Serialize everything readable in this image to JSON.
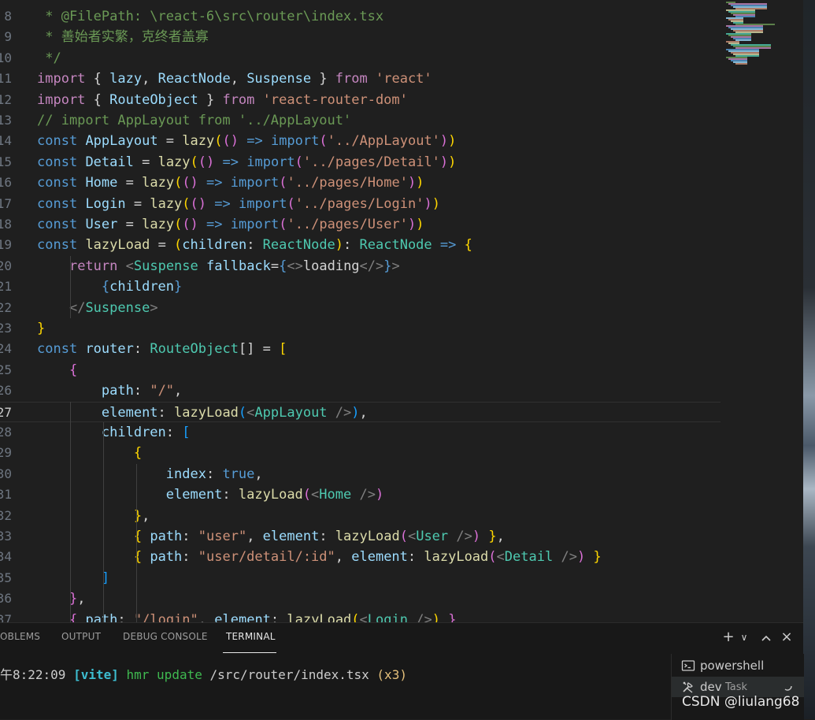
{
  "editor": {
    "current_line": 27,
    "lines": [
      {
        "n": "8",
        "t": [
          [
            "c-g",
            " * @FilePath: \\react-6\\src\\router\\index.tsx"
          ]
        ]
      },
      {
        "n": "9",
        "t": [
          [
            "c-g",
            " * 善始者实繁，克终者盖寡"
          ]
        ]
      },
      {
        "n": "10",
        "t": [
          [
            "c-g",
            " */"
          ]
        ]
      },
      {
        "n": "11",
        "t": [
          [
            "c-c",
            "import"
          ],
          [
            "c-w",
            " { "
          ],
          [
            "c-v",
            "lazy"
          ],
          [
            "c-w",
            ", "
          ],
          [
            "c-v",
            "ReactNode"
          ],
          [
            "c-w",
            ", "
          ],
          [
            "c-v",
            "Suspense"
          ],
          [
            "c-w",
            " } "
          ],
          [
            "c-c",
            "from"
          ],
          [
            "c-w",
            " "
          ],
          [
            "c-s",
            "'react'"
          ]
        ]
      },
      {
        "n": "12",
        "t": [
          [
            "c-c",
            "import"
          ],
          [
            "c-w",
            " { "
          ],
          [
            "c-v",
            "RouteObject"
          ],
          [
            "c-w",
            " } "
          ],
          [
            "c-c",
            "from"
          ],
          [
            "c-w",
            " "
          ],
          [
            "c-s",
            "'react-router-dom'"
          ]
        ]
      },
      {
        "n": "13",
        "t": [
          [
            "c-g",
            "// import AppLayout from '../AppLayout'"
          ]
        ]
      },
      {
        "n": "14",
        "t": [
          [
            "c-k",
            "const"
          ],
          [
            "c-w",
            " "
          ],
          [
            "c-v",
            "AppLayout"
          ],
          [
            "c-w",
            " = "
          ],
          [
            "c-f",
            "lazy"
          ],
          [
            "c-y",
            "("
          ],
          [
            "c-m",
            "()"
          ],
          [
            "c-w",
            " "
          ],
          [
            "c-k",
            "=>"
          ],
          [
            "c-w",
            " "
          ],
          [
            "c-k",
            "import"
          ],
          [
            "c-m",
            "("
          ],
          [
            "c-s",
            "'../AppLayout'"
          ],
          [
            "c-m",
            ")"
          ],
          [
            "c-y",
            ")"
          ]
        ]
      },
      {
        "n": "15",
        "t": [
          [
            "c-k",
            "const"
          ],
          [
            "c-w",
            " "
          ],
          [
            "c-v",
            "Detail"
          ],
          [
            "c-w",
            " = "
          ],
          [
            "c-f",
            "lazy"
          ],
          [
            "c-y",
            "("
          ],
          [
            "c-m",
            "()"
          ],
          [
            "c-w",
            " "
          ],
          [
            "c-k",
            "=>"
          ],
          [
            "c-w",
            " "
          ],
          [
            "c-k",
            "import"
          ],
          [
            "c-m",
            "("
          ],
          [
            "c-s",
            "'../pages/Detail'"
          ],
          [
            "c-m",
            ")"
          ],
          [
            "c-y",
            ")"
          ]
        ]
      },
      {
        "n": "16",
        "t": [
          [
            "c-k",
            "const"
          ],
          [
            "c-w",
            " "
          ],
          [
            "c-v",
            "Home"
          ],
          [
            "c-w",
            " = "
          ],
          [
            "c-f",
            "lazy"
          ],
          [
            "c-y",
            "("
          ],
          [
            "c-m",
            "()"
          ],
          [
            "c-w",
            " "
          ],
          [
            "c-k",
            "=>"
          ],
          [
            "c-w",
            " "
          ],
          [
            "c-k",
            "import"
          ],
          [
            "c-m",
            "("
          ],
          [
            "c-s",
            "'../pages/Home'"
          ],
          [
            "c-m",
            ")"
          ],
          [
            "c-y",
            ")"
          ]
        ]
      },
      {
        "n": "17",
        "t": [
          [
            "c-k",
            "const"
          ],
          [
            "c-w",
            " "
          ],
          [
            "c-v",
            "Login"
          ],
          [
            "c-w",
            " = "
          ],
          [
            "c-f",
            "lazy"
          ],
          [
            "c-y",
            "("
          ],
          [
            "c-m",
            "()"
          ],
          [
            "c-w",
            " "
          ],
          [
            "c-k",
            "=>"
          ],
          [
            "c-w",
            " "
          ],
          [
            "c-k",
            "import"
          ],
          [
            "c-m",
            "("
          ],
          [
            "c-s",
            "'../pages/Login'"
          ],
          [
            "c-m",
            ")"
          ],
          [
            "c-y",
            ")"
          ]
        ]
      },
      {
        "n": "18",
        "t": [
          [
            "c-k",
            "const"
          ],
          [
            "c-w",
            " "
          ],
          [
            "c-v",
            "User"
          ],
          [
            "c-w",
            " = "
          ],
          [
            "c-f",
            "lazy"
          ],
          [
            "c-y",
            "("
          ],
          [
            "c-m",
            "()"
          ],
          [
            "c-w",
            " "
          ],
          [
            "c-k",
            "=>"
          ],
          [
            "c-w",
            " "
          ],
          [
            "c-k",
            "import"
          ],
          [
            "c-m",
            "("
          ],
          [
            "c-s",
            "'../pages/User'"
          ],
          [
            "c-m",
            ")"
          ],
          [
            "c-y",
            ")"
          ]
        ]
      },
      {
        "n": "19",
        "t": [
          [
            "c-k",
            "const"
          ],
          [
            "c-w",
            " "
          ],
          [
            "c-f",
            "lazyLoad"
          ],
          [
            "c-w",
            " = "
          ],
          [
            "c-y",
            "("
          ],
          [
            "c-v",
            "children"
          ],
          [
            "c-w",
            ": "
          ],
          [
            "c-t",
            "ReactNode"
          ],
          [
            "c-y",
            ")"
          ],
          [
            "c-w",
            ": "
          ],
          [
            "c-t",
            "ReactNode"
          ],
          [
            "c-w",
            " "
          ],
          [
            "c-k",
            "=>"
          ],
          [
            "c-w",
            " "
          ],
          [
            "c-y",
            "{"
          ]
        ]
      },
      {
        "n": "20",
        "t": [
          [
            "c-w",
            "    "
          ],
          [
            "c-c",
            "return"
          ],
          [
            "c-w",
            " "
          ],
          [
            "c-p",
            "<"
          ],
          [
            "c-t",
            "Suspense"
          ],
          [
            "c-w",
            " "
          ],
          [
            "c-v",
            "fallback"
          ],
          [
            "c-w",
            "="
          ],
          [
            "c-k",
            "{"
          ],
          [
            "c-p",
            "<>"
          ],
          [
            "c-w",
            "loading"
          ],
          [
            "c-p",
            "</>"
          ],
          [
            "c-k",
            "}"
          ],
          [
            "c-p",
            ">"
          ]
        ]
      },
      {
        "n": "21",
        "t": [
          [
            "c-w",
            "        "
          ],
          [
            "c-k",
            "{"
          ],
          [
            "c-v",
            "children"
          ],
          [
            "c-k",
            "}"
          ]
        ]
      },
      {
        "n": "22",
        "t": [
          [
            "c-w",
            "    "
          ],
          [
            "c-p",
            "</"
          ],
          [
            "c-t",
            "Suspense"
          ],
          [
            "c-p",
            ">"
          ]
        ]
      },
      {
        "n": "23",
        "t": [
          [
            "c-y",
            "}"
          ]
        ]
      },
      {
        "n": "24",
        "t": [
          [
            "c-k",
            "const"
          ],
          [
            "c-w",
            " "
          ],
          [
            "c-v",
            "router"
          ],
          [
            "c-w",
            ": "
          ],
          [
            "c-t",
            "RouteObject"
          ],
          [
            "c-w",
            "[] = "
          ],
          [
            "c-y",
            "["
          ]
        ]
      },
      {
        "n": "25",
        "t": [
          [
            "c-w",
            "    "
          ],
          [
            "c-m",
            "{"
          ]
        ]
      },
      {
        "n": "26",
        "t": [
          [
            "c-w",
            "        "
          ],
          [
            "c-v",
            "path"
          ],
          [
            "c-w",
            ": "
          ],
          [
            "c-s",
            "\"/\""
          ],
          [
            "c-w",
            ","
          ]
        ]
      },
      {
        "n": "27",
        "t": [
          [
            "c-w",
            "        "
          ],
          [
            "c-v",
            "element"
          ],
          [
            "c-w",
            ": "
          ],
          [
            "c-f",
            "lazyLoad"
          ],
          [
            "c-b",
            "("
          ],
          [
            "c-p",
            "<"
          ],
          [
            "c-t",
            "AppLayout"
          ],
          [
            "c-w",
            " "
          ],
          [
            "c-p",
            "/>"
          ],
          [
            "c-b",
            ")"
          ],
          [
            "c-w",
            ","
          ]
        ]
      },
      {
        "n": "28",
        "t": [
          [
            "c-w",
            "        "
          ],
          [
            "c-v",
            "children"
          ],
          [
            "c-w",
            ": "
          ],
          [
            "c-b",
            "["
          ]
        ]
      },
      {
        "n": "29",
        "t": [
          [
            "c-w",
            "            "
          ],
          [
            "c-y",
            "{"
          ]
        ]
      },
      {
        "n": "30",
        "t": [
          [
            "c-w",
            "                "
          ],
          [
            "c-v",
            "index"
          ],
          [
            "c-w",
            ": "
          ],
          [
            "c-k",
            "true"
          ],
          [
            "c-w",
            ","
          ]
        ]
      },
      {
        "n": "31",
        "t": [
          [
            "c-w",
            "                "
          ],
          [
            "c-v",
            "element"
          ],
          [
            "c-w",
            ": "
          ],
          [
            "c-f",
            "lazyLoad"
          ],
          [
            "c-m",
            "("
          ],
          [
            "c-p",
            "<"
          ],
          [
            "c-t",
            "Home"
          ],
          [
            "c-w",
            " "
          ],
          [
            "c-p",
            "/>"
          ],
          [
            "c-m",
            ")"
          ]
        ]
      },
      {
        "n": "32",
        "t": [
          [
            "c-w",
            "            "
          ],
          [
            "c-y",
            "}"
          ],
          [
            "c-w",
            ","
          ]
        ]
      },
      {
        "n": "33",
        "t": [
          [
            "c-w",
            "            "
          ],
          [
            "c-y",
            "{"
          ],
          [
            "c-w",
            " "
          ],
          [
            "c-v",
            "path"
          ],
          [
            "c-w",
            ": "
          ],
          [
            "c-s",
            "\"user\""
          ],
          [
            "c-w",
            ", "
          ],
          [
            "c-v",
            "element"
          ],
          [
            "c-w",
            ": "
          ],
          [
            "c-f",
            "lazyLoad"
          ],
          [
            "c-m",
            "("
          ],
          [
            "c-p",
            "<"
          ],
          [
            "c-t",
            "User"
          ],
          [
            "c-w",
            " "
          ],
          [
            "c-p",
            "/>"
          ],
          [
            "c-m",
            ")"
          ],
          [
            "c-w",
            " "
          ],
          [
            "c-y",
            "}"
          ],
          [
            "c-w",
            ","
          ]
        ]
      },
      {
        "n": "34",
        "t": [
          [
            "c-w",
            "            "
          ],
          [
            "c-y",
            "{"
          ],
          [
            "c-w",
            " "
          ],
          [
            "c-v",
            "path"
          ],
          [
            "c-w",
            ": "
          ],
          [
            "c-s",
            "\"user/detail/:id\""
          ],
          [
            "c-w",
            ", "
          ],
          [
            "c-v",
            "element"
          ],
          [
            "c-w",
            ": "
          ],
          [
            "c-f",
            "lazyLoad"
          ],
          [
            "c-m",
            "("
          ],
          [
            "c-p",
            "<"
          ],
          [
            "c-t",
            "Detail"
          ],
          [
            "c-w",
            " "
          ],
          [
            "c-p",
            "/>"
          ],
          [
            "c-m",
            ")"
          ],
          [
            "c-w",
            " "
          ],
          [
            "c-y",
            "}"
          ]
        ]
      },
      {
        "n": "35",
        "t": [
          [
            "c-w",
            "        "
          ],
          [
            "c-b",
            "]"
          ]
        ]
      },
      {
        "n": "36",
        "t": [
          [
            "c-w",
            "    "
          ],
          [
            "c-m",
            "}"
          ],
          [
            "c-w",
            ","
          ]
        ]
      },
      {
        "n": "37",
        "t": [
          [
            "c-w",
            "    "
          ],
          [
            "c-m",
            "{"
          ],
          [
            "c-w",
            " "
          ],
          [
            "c-v",
            "path"
          ],
          [
            "c-w",
            ": "
          ],
          [
            "c-s",
            "\"/login\""
          ],
          [
            "c-w",
            ", "
          ],
          [
            "c-v",
            "element"
          ],
          [
            "c-w",
            ": "
          ],
          [
            "c-f",
            "lazyLoad"
          ],
          [
            "c-y",
            "("
          ],
          [
            "c-p",
            "<"
          ],
          [
            "c-t",
            "Login"
          ],
          [
            "c-w",
            " "
          ],
          [
            "c-p",
            "/>"
          ],
          [
            "c-y",
            ")"
          ],
          [
            "c-w",
            " "
          ],
          [
            "c-m",
            "}"
          ]
        ]
      }
    ]
  },
  "panel": {
    "tabs": [
      {
        "label": "OBLEMS",
        "active": false
      },
      {
        "label": "OUTPUT",
        "active": false
      },
      {
        "label": "DEBUG CONSOLE",
        "active": false
      },
      {
        "label": "TERMINAL",
        "active": true
      }
    ],
    "actions": {
      "new_terminal": "+",
      "more": "∨",
      "maximize": "^",
      "close": "×"
    },
    "terminal_output": {
      "time": "午8:22:09",
      "tag": "[vite]",
      "message": "hmr update",
      "path": "/src/router/index.tsx",
      "count": "(x3)"
    },
    "terminals": [
      {
        "name": "powershell",
        "sub": "",
        "icon": "terminal-icon"
      },
      {
        "name": "dev",
        "sub": "Task",
        "icon": "tools-icon"
      }
    ]
  },
  "watermark": "CSDN @liulang68",
  "colors": {
    "editor_bg": "#1f1f1f",
    "keyword": "#569cd6",
    "control": "#c586c0",
    "variable": "#9cdcfe",
    "string": "#ce9178",
    "type": "#4ec9b0",
    "function": "#dcdcaa",
    "comment": "#6a9955",
    "vite_tag": "#3dbdd0",
    "hmr": "#3fb950",
    "count": "#e5c07b"
  }
}
